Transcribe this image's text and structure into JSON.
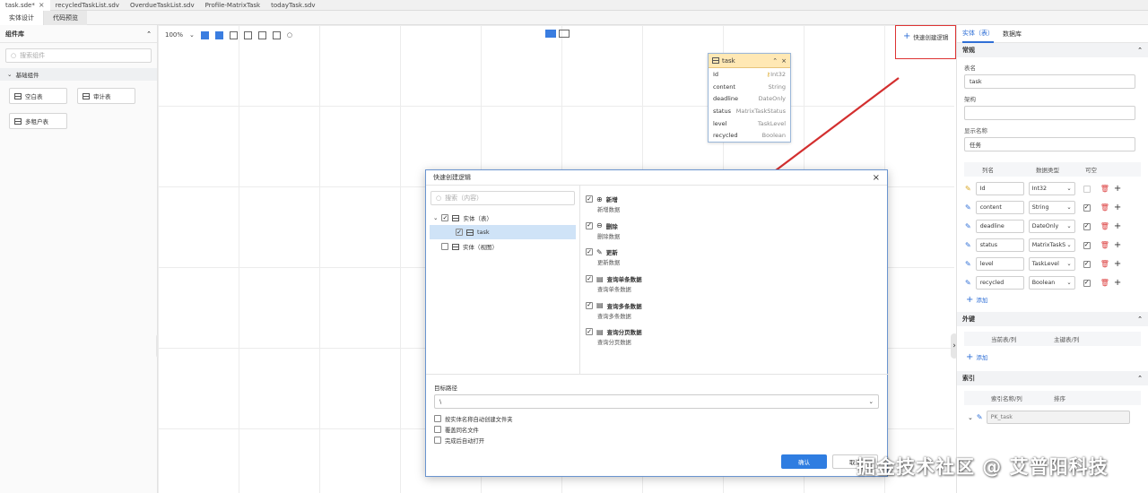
{
  "file_tabs": [
    {
      "label": "task.sde*",
      "active": true
    },
    {
      "label": "recycledTaskList.sdv"
    },
    {
      "label": "OverdueTaskList.sdv"
    },
    {
      "label": "Profile-MatrixTask"
    },
    {
      "label": "todayTask.sdv"
    }
  ],
  "sub_tabs": [
    "实体设计",
    "代码预览"
  ],
  "left_panel": {
    "title": "组件库",
    "search_placeholder": "搜索组件",
    "group": "基础组件",
    "components": [
      "空白表",
      "审计表",
      "多租户表"
    ]
  },
  "toolbar": {
    "zoom": "100%"
  },
  "entity_card": {
    "name": "task",
    "fields": [
      {
        "name": "Id",
        "type": "Int32",
        "key": true
      },
      {
        "name": "content",
        "type": "String"
      },
      {
        "name": "deadline",
        "type": "DateOnly"
      },
      {
        "name": "status",
        "type": "MatrixTaskStatus"
      },
      {
        "name": "level",
        "type": "TaskLevel"
      },
      {
        "name": "recycled",
        "type": "Boolean"
      }
    ]
  },
  "quick_create_label": "快速创建逻辑",
  "right_panel": {
    "tabs": [
      "实体（表）",
      "数据库"
    ],
    "section_general": "常规",
    "table_name_label": "表名",
    "table_name_value": "task",
    "schema_label": "架构",
    "schema_value": "",
    "display_name_label": "显示名称",
    "display_name_value": "任务",
    "col_headers": [
      "列名",
      "数据类型",
      "可空"
    ],
    "columns": [
      {
        "name": "Id",
        "type": "Int32",
        "nullable": false,
        "disabled": true,
        "key": true
      },
      {
        "name": "content",
        "type": "String",
        "nullable": true
      },
      {
        "name": "deadline",
        "type": "DateOnly",
        "nullable": true
      },
      {
        "name": "status",
        "type": "MatrixTaskS",
        "nullable": true
      },
      {
        "name": "level",
        "type": "TaskLevel",
        "nullable": true
      },
      {
        "name": "recycled",
        "type": "Boolean",
        "nullable": true
      }
    ],
    "add_label": "添加",
    "section_fk": "外键",
    "fk_headers": [
      "当前表/列",
      "主键表/列"
    ],
    "section_index": "索引",
    "index_headers": [
      "索引名称/列",
      "排序"
    ],
    "index_value": "PK_task"
  },
  "dialog": {
    "title": "快速创建逻辑",
    "search_placeholder": "搜索（内容）",
    "tree": [
      {
        "label": "实体（表）",
        "checked": true,
        "level": 0,
        "expanded": true
      },
      {
        "label": "task",
        "checked": true,
        "level": 1,
        "selected": true
      },
      {
        "label": "实体（视图）",
        "checked": false,
        "level": 0
      }
    ],
    "options": [
      {
        "title": "新增",
        "desc": "新增数据",
        "icon": "plus"
      },
      {
        "title": "删除",
        "desc": "删除数据",
        "icon": "minus"
      },
      {
        "title": "更新",
        "desc": "更新数据",
        "icon": "edit"
      },
      {
        "title": "查询单条数据",
        "desc": "查询单条数据",
        "icon": "doc"
      },
      {
        "title": "查询多条数据",
        "desc": "查询多条数据",
        "icon": "doc"
      },
      {
        "title": "查询分页数据",
        "desc": "查询分页数据",
        "icon": "doc"
      }
    ],
    "target_label": "目标路径",
    "target_value": "\\",
    "checkboxes": [
      "按实体名称自动创建文件夹",
      "覆盖同名文件",
      "完成后自动打开"
    ],
    "confirm": "确认",
    "cancel": "取消"
  },
  "watermark": "掘金技术社区 @ 艾普阳科技",
  "colors": {
    "accent": "#2f7de1",
    "highlight_box": "#d33333",
    "arrow": "#d32f2f",
    "entity_header": "#ffe8b4"
  }
}
